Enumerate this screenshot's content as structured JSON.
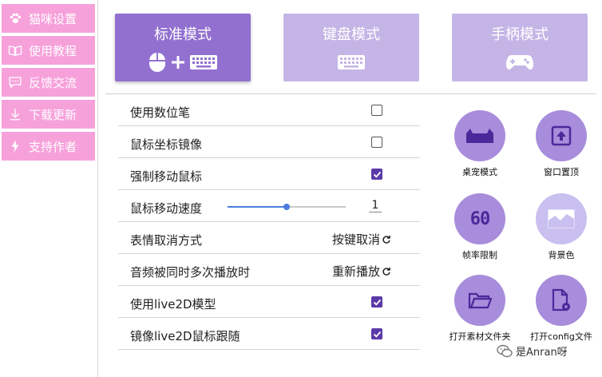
{
  "sidebar": {
    "items": [
      {
        "label": "猫咪设置",
        "icon": "paw-icon"
      },
      {
        "label": "使用教程",
        "icon": "book-icon"
      },
      {
        "label": "反馈交流",
        "icon": "chat-icon"
      },
      {
        "label": "下载更新",
        "icon": "download-icon"
      },
      {
        "label": "支持作者",
        "icon": "lightning-icon"
      }
    ]
  },
  "modes": [
    {
      "label": "标准模式",
      "icons": "mouse-plus-keyboard-icon",
      "selected": true
    },
    {
      "label": "键盘模式",
      "icons": "keyboard-icon",
      "selected": false
    },
    {
      "label": "手柄模式",
      "icons": "gamepad-icon",
      "selected": false
    }
  ],
  "settings": [
    {
      "label": "使用数位笔",
      "type": "checkbox",
      "checked": false
    },
    {
      "label": "鼠标坐标镜像",
      "type": "checkbox",
      "checked": false
    },
    {
      "label": "强制移动鼠标",
      "type": "checkbox",
      "checked": true
    },
    {
      "label": "鼠标移动速度",
      "type": "slider",
      "value": "1",
      "fraction": 0.5
    },
    {
      "label": "表情取消方式",
      "type": "select",
      "value": "按键取消"
    },
    {
      "label": "音频被同时多次播放时",
      "type": "select",
      "value": "重新播放"
    },
    {
      "label": "使用live2D模型",
      "type": "checkbox",
      "checked": true
    },
    {
      "label": "镜像live2D鼠标跟随",
      "type": "checkbox",
      "checked": true
    }
  ],
  "actions": [
    {
      "label": "桌宠模式",
      "icon": "cat-silhouette-icon"
    },
    {
      "label": "窗口置顶",
      "icon": "pin-top-icon"
    },
    {
      "label": "帧率限制",
      "icon": "fps-60-icon",
      "badge": "60"
    },
    {
      "label": "背景色",
      "icon": "background-image-icon"
    },
    {
      "label": "打开素材文件夹",
      "icon": "folder-open-icon"
    },
    {
      "label": "打开config文件",
      "icon": "file-settings-icon"
    }
  ],
  "colors": {
    "sidebar_pink": "#f7a1db",
    "mode_active": "#9270d0",
    "mode_inactive": "#c5b5e6",
    "checkbox_checked": "#5b3aa8",
    "slider_blue": "#4a7de0",
    "circle_dark": "#a78ddb",
    "circle_light": "#c9c0f0"
  },
  "watermark": {
    "text": "是Anran呀",
    "icon": "wechat-icon"
  }
}
